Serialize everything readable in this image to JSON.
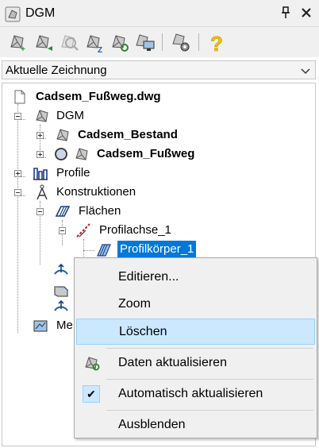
{
  "window": {
    "title": "DGM",
    "pin_icon": "pin-icon",
    "close_icon": "close-icon"
  },
  "toolbar": {
    "buttons": [
      "dgm-new-icon",
      "dgm-add-icon",
      "dgm-zoom-icon",
      "dgm-z-icon",
      "dgm-refresh-icon",
      "dgm-screen-icon",
      "dgm-settings-icon",
      "help-icon"
    ]
  },
  "combo": {
    "value": "Aktuelle Zeichnung"
  },
  "tree": {
    "root": "Cadsem_Fußweg.dwg",
    "dgm": "DGM",
    "dgm_child1": "Cadsem_Bestand",
    "dgm_child2": "Cadsem_Fußweg",
    "profile": "Profile",
    "konstruktionen": "Konstruktionen",
    "flaechen": "Flächen",
    "profilachse": "Profilachse_1",
    "profilkoerper": "Profilkörper_1",
    "partial": "Me"
  },
  "context_menu": {
    "edit": "Editieren...",
    "zoom": "Zoom",
    "delete": "Löschen",
    "refresh": "Daten aktualisieren",
    "auto_refresh": "Automatisch aktualisieren",
    "auto_checked": "✔",
    "hide": "Ausblenden"
  },
  "colors": {
    "selection": "#0078d7",
    "hover": "#cce8ff",
    "help": "#f2c200"
  }
}
